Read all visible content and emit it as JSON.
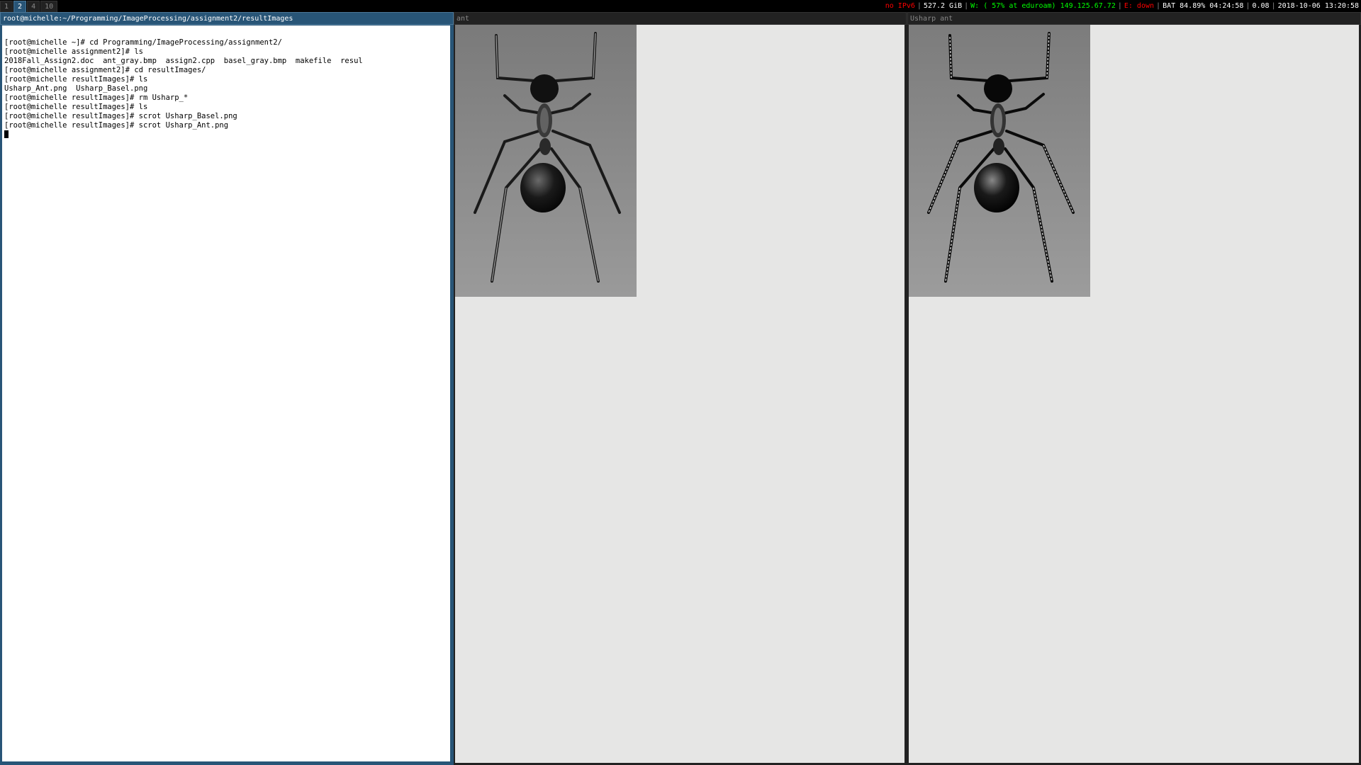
{
  "workspaces": [
    {
      "label": "1",
      "active": false
    },
    {
      "label": "2",
      "active": true
    },
    {
      "label": "4",
      "active": false
    },
    {
      "label": "10",
      "active": false
    }
  ],
  "status": {
    "ipv6": "no IPv6",
    "disk": "527.2 GiB",
    "wifi": "W: ( 57% at eduroam) 149.125.67.72",
    "ethernet": "E: down",
    "battery": "BAT 84.89% 04:24:58",
    "load": "0.08",
    "datetime": "2018-10-06 13:20:58",
    "colors": {
      "bad": "#ff0000",
      "good": "#00ff00",
      "normal": "#ffffff"
    }
  },
  "terminal": {
    "title": "root@michelle:~/Programming/ImageProcessing/assignment2/resultImages",
    "lines": [
      "[root@michelle ~]# cd Programming/ImageProcessing/assignment2/",
      "[root@michelle assignment2]# ls",
      "2018Fall_Assign2.doc  ant_gray.bmp  assign2.cpp  basel_gray.bmp  makefile  resul",
      "[root@michelle assignment2]# cd resultImages/",
      "[root@michelle resultImages]# ls",
      "Usharp_Ant.png  Usharp_Basel.png",
      "[root@michelle resultImages]# rm Usharp_*",
      "[root@michelle resultImages]# ls",
      "[root@michelle resultImages]# scrot Usharp_Basel.png",
      "[root@michelle resultImages]# scrot Usharp_Ant.png"
    ]
  },
  "viewers": [
    {
      "title": "ant",
      "image_icon": "ant-photo"
    },
    {
      "title": "Usharp ant",
      "image_icon": "ant-photo-sharpened"
    }
  ],
  "colors": {
    "focused_title": "#285577",
    "unfocused_title": "#222222",
    "viewer_background": "#e6e6e5"
  }
}
